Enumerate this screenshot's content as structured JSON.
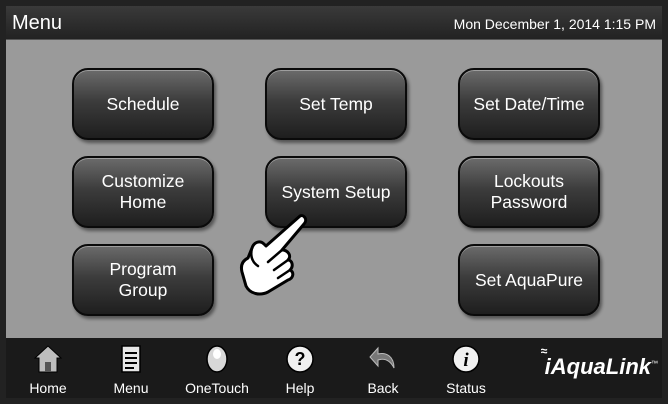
{
  "header": {
    "title": "Menu",
    "datetime": "Mon December 1, 2014 1:15 PM"
  },
  "buttons": {
    "schedule": "Schedule",
    "set_temp": "Set Temp",
    "set_date_time": "Set Date/Time",
    "customize_home_1": "Customize",
    "customize_home_2": "Home",
    "system_setup": "System Setup",
    "lockouts_1": "Lockouts",
    "lockouts_2": "Password",
    "program_group_1": "Program",
    "program_group_2": "Group",
    "set_aquapure": "Set AquaPure"
  },
  "nav": {
    "home": "Home",
    "menu": "Menu",
    "onetouch": "OneTouch",
    "help": "Help",
    "back": "Back",
    "status": "Status"
  },
  "brand": {
    "logo_text": "AquaLink",
    "prefix": "i",
    "tm": "™"
  },
  "colors": {
    "panel_background": "#9a9a9a",
    "button_dark": "#1e1e1e",
    "text": "#ffffff"
  },
  "icons": [
    "home-icon",
    "menu-icon",
    "onetouch-icon",
    "help-icon",
    "back-icon",
    "status-icon",
    "pointing-hand-icon"
  ]
}
